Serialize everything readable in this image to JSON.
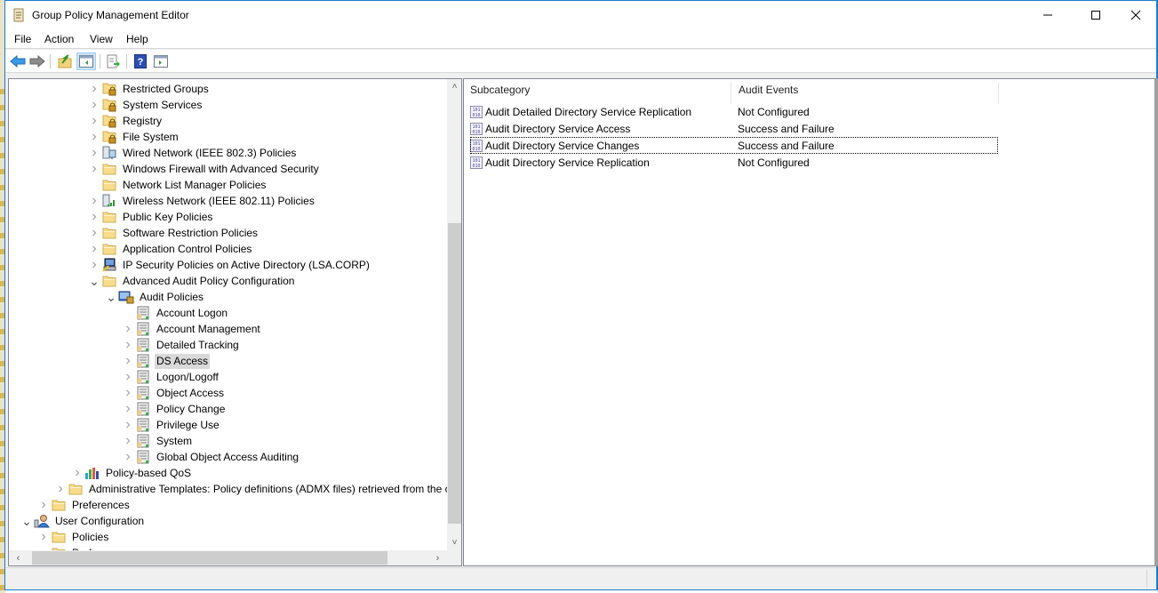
{
  "window": {
    "title": "Group Policy Management Editor",
    "icon": "scroll-icon",
    "controls": [
      "minimize-icon",
      "maximize-icon",
      "close-icon"
    ]
  },
  "menu": [
    "File",
    "Action",
    "View",
    "Help"
  ],
  "toolbar": [
    {
      "name": "back-button",
      "icon": "arrow-left-icon"
    },
    {
      "name": "forward-button",
      "icon": "arrow-right-icon"
    },
    {
      "name": "up-one-level-button",
      "icon": "folder-up-icon"
    },
    {
      "name": "show-hide-console-tree-button",
      "icon": "console-tree-icon",
      "active": true
    },
    {
      "name": "export-list-button",
      "icon": "export-list-icon"
    },
    {
      "name": "help-button",
      "icon": "help-icon"
    },
    {
      "name": "show-hide-action-pane-button",
      "icon": "action-pane-icon"
    }
  ],
  "tree": [
    {
      "label": "Restricted Groups",
      "level": 4,
      "expander": "collapsed",
      "icon": "locked-folder-icon"
    },
    {
      "label": "System Services",
      "level": 4,
      "expander": "collapsed",
      "icon": "locked-folder-icon"
    },
    {
      "label": "Registry",
      "level": 4,
      "expander": "collapsed",
      "icon": "locked-folder-icon"
    },
    {
      "label": "File System",
      "level": 4,
      "expander": "collapsed",
      "icon": "locked-folder-icon"
    },
    {
      "label": "Wired Network (IEEE 802.3) Policies",
      "level": 4,
      "expander": "collapsed",
      "icon": "wired-network-icon"
    },
    {
      "label": "Windows Firewall with Advanced Security",
      "level": 4,
      "expander": "collapsed",
      "icon": "folder-icon"
    },
    {
      "label": "Network List Manager Policies",
      "level": 4,
      "expander": "none",
      "icon": "folder-icon"
    },
    {
      "label": "Wireless Network (IEEE 802.11) Policies",
      "level": 4,
      "expander": "collapsed",
      "icon": "wireless-network-icon"
    },
    {
      "label": "Public Key Policies",
      "level": 4,
      "expander": "collapsed",
      "icon": "folder-icon"
    },
    {
      "label": "Software Restriction Policies",
      "level": 4,
      "expander": "collapsed",
      "icon": "folder-icon"
    },
    {
      "label": "Application Control Policies",
      "level": 4,
      "expander": "collapsed",
      "icon": "folder-icon"
    },
    {
      "label": "IP Security Policies on Active Directory (LSA.CORP)",
      "level": 4,
      "expander": "collapsed",
      "icon": "ip-security-icon"
    },
    {
      "label": "Advanced Audit Policy Configuration",
      "level": 4,
      "expander": "expanded",
      "icon": "folder-icon"
    },
    {
      "label": "Audit Policies",
      "level": 5,
      "expander": "expanded",
      "icon": "audit-policies-icon"
    },
    {
      "label": "Account Logon",
      "level": 6,
      "expander": "none",
      "icon": "policy-category-icon"
    },
    {
      "label": "Account Management",
      "level": 6,
      "expander": "collapsed",
      "icon": "policy-category-icon"
    },
    {
      "label": "Detailed Tracking",
      "level": 6,
      "expander": "collapsed",
      "icon": "policy-category-icon"
    },
    {
      "label": "DS Access",
      "level": 6,
      "expander": "collapsed",
      "icon": "policy-category-icon",
      "selected": true
    },
    {
      "label": "Logon/Logoff",
      "level": 6,
      "expander": "collapsed",
      "icon": "policy-category-icon"
    },
    {
      "label": "Object Access",
      "level": 6,
      "expander": "collapsed",
      "icon": "policy-category-icon"
    },
    {
      "label": "Policy Change",
      "level": 6,
      "expander": "collapsed",
      "icon": "policy-category-icon"
    },
    {
      "label": "Privilege Use",
      "level": 6,
      "expander": "collapsed",
      "icon": "policy-category-icon"
    },
    {
      "label": "System",
      "level": 6,
      "expander": "collapsed",
      "icon": "policy-category-icon"
    },
    {
      "label": "Global Object Access Auditing",
      "level": 6,
      "expander": "collapsed",
      "icon": "policy-category-icon"
    },
    {
      "label": "Policy-based QoS",
      "level": 3,
      "expander": "collapsed",
      "icon": "qos-chart-icon"
    },
    {
      "label": "Administrative Templates: Policy definitions (ADMX files) retrieved from the c",
      "level": 2,
      "expander": "collapsed",
      "icon": "folder-icon"
    },
    {
      "label": "Preferences",
      "level": 1,
      "expander": "collapsed",
      "icon": "folder-icon"
    },
    {
      "label": "User Configuration",
      "level": 0,
      "expander": "expanded",
      "icon": "user-config-icon"
    },
    {
      "label": "Policies",
      "level": 1,
      "expander": "collapsed",
      "icon": "folder-icon"
    },
    {
      "label": "Preferences",
      "level": 1,
      "expander": "collapsed",
      "icon": "folder-icon",
      "clipped": true
    }
  ],
  "list": {
    "columns": [
      "Subcategory",
      "Audit Events"
    ],
    "rows": [
      {
        "subcategory": "Audit Detailed Directory Service Replication",
        "audit_events": "Not Configured"
      },
      {
        "subcategory": "Audit Directory Service Access",
        "audit_events": "Success and Failure"
      },
      {
        "subcategory": "Audit Directory Service Changes",
        "audit_events": "Success and Failure",
        "focused": true
      },
      {
        "subcategory": "Audit Directory Service Replication",
        "audit_events": "Not Configured"
      }
    ]
  },
  "colors": {
    "window_border": "#1a7ad4",
    "selection": "#d9d9d9",
    "toolbar_active": "#cce4f7",
    "folder": "#f2d27a"
  }
}
